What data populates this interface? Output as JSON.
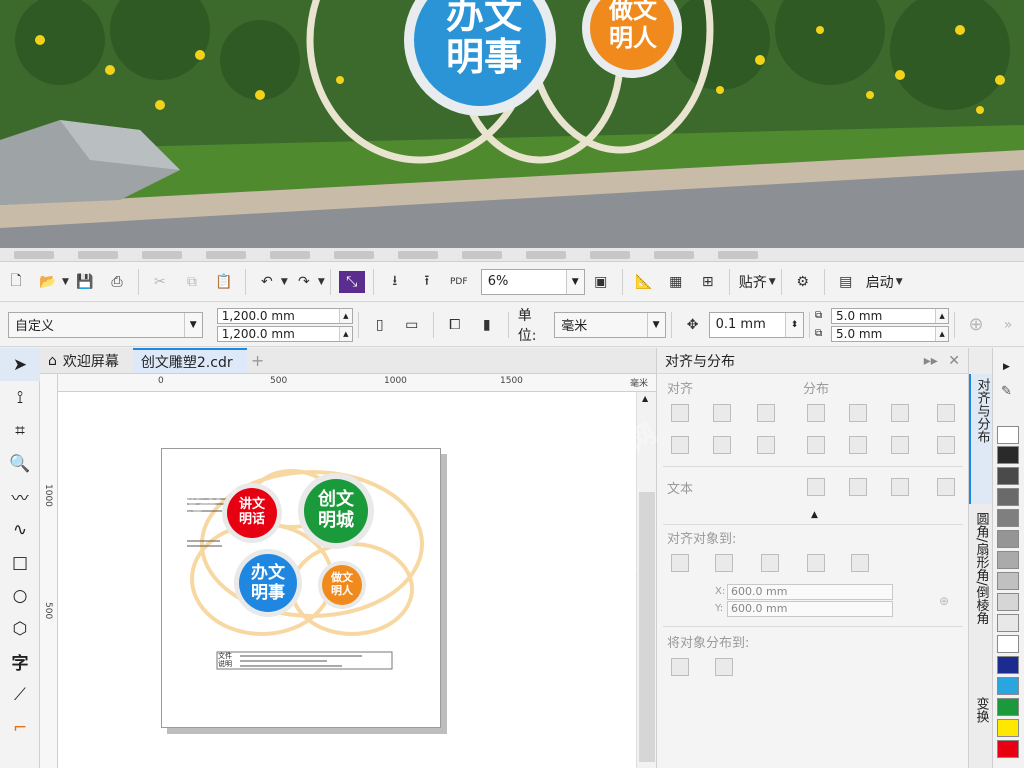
{
  "photo": {
    "sign_left": [
      "办文",
      "明事"
    ],
    "sign_right": [
      "做文",
      "明人"
    ]
  },
  "toolbar1": {
    "zoom_value": "6%",
    "snap_label": "贴齐",
    "launch_label": "启动",
    "pdf_label": "PDF"
  },
  "toolbar2": {
    "preset_value": "自定义",
    "width_value": "1,200.0 mm",
    "height_value": "1,200.0 mm",
    "unit_label": "单位:",
    "unit_value": "毫米",
    "nudge_value": "0.1 mm",
    "dup_x": "5.0 mm",
    "dup_y": "5.0 mm"
  },
  "tabs": [
    {
      "label": "欢迎屏幕"
    },
    {
      "label": "创文雕塑2.cdr"
    }
  ],
  "rulers": {
    "h_ticks": [
      "0",
      "500",
      "1000",
      "1500"
    ],
    "h_unit": "毫米",
    "v_ticks": [
      "1000",
      "500"
    ]
  },
  "design": {
    "circle1": [
      "讲文",
      "明话"
    ],
    "circle2": [
      "创文",
      "明城"
    ],
    "circle3": [
      "办文",
      "明事"
    ],
    "circle4": [
      "做文",
      "明人"
    ],
    "note": [
      "文件",
      "说明"
    ]
  },
  "docker": {
    "title": "对齐与分布",
    "align_label": "对齐",
    "distribute_label": "分布",
    "text_label": "文本",
    "align_to_label": "对齐对象到:",
    "x_value": "600.0 mm",
    "y_value": "600.0 mm",
    "x_axis": "X:",
    "y_axis": "Y:",
    "distribute_to_label": "将对象分布到:"
  },
  "side_tabs": [
    {
      "label": "对齐与分布"
    },
    {
      "label": "圆角/扇形角/倒棱角"
    },
    {
      "label": "变换"
    }
  ],
  "palette_colors": [
    "#ffffff",
    "#2a2a2a",
    "#4a4a4a",
    "#6a6a6a",
    "#7f7f7f",
    "#959595",
    "#aaaaaa",
    "#c0c0c0",
    "#d6d6d6",
    "#e8e8e8",
    "#ffffff",
    "#1c2b8f",
    "#29a5e0",
    "#1a9a3a",
    "#ffe800",
    "#e60012"
  ],
  "colors": {
    "accent": "#1f87e0",
    "red": "#e60012",
    "green": "#1a9a3a",
    "blue": "#1f87e0",
    "orange": "#f08a1c"
  }
}
